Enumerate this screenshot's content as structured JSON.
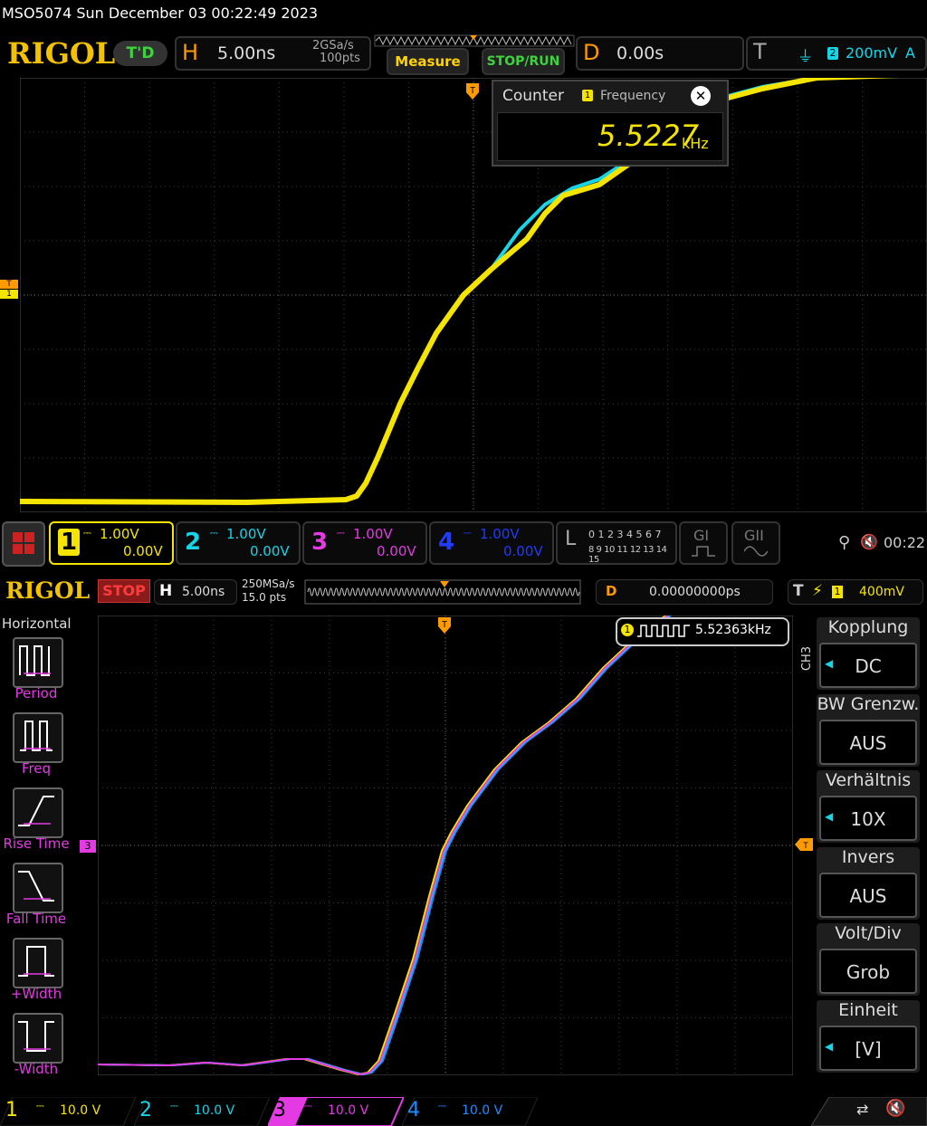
{
  "top": {
    "title": "MSO5074  Sun December 03 00:22:49 2023",
    "logo": "RIGOL",
    "td_badge": "T'D",
    "h_label": "H",
    "h_timebase": "5.00ns",
    "h_sa": "2GSa/s",
    "h_pts": "100pts",
    "measure_label": "Measure",
    "stoprun_label": "STOP/RUN",
    "d_label": "D",
    "d_value": "0.00s",
    "t_label": "T",
    "t_channel": "2",
    "t_level": "200mV",
    "t_mode": "A",
    "counter": {
      "title": "Counter",
      "channel": "1",
      "type": "Frequency",
      "value": "5.5227",
      "unit": "kHz"
    },
    "channels": [
      {
        "num": "1",
        "volt": "1.00V",
        "offset": "0.00V",
        "color": "#f5e400"
      },
      {
        "num": "2",
        "volt": "1.00V",
        "offset": "0.00V",
        "color": "#19d4e6"
      },
      {
        "num": "3",
        "volt": "1.00V",
        "offset": "0.00V",
        "color": "#e43ae4"
      },
      {
        "num": "4",
        "volt": "1.00V",
        "offset": "0.00V",
        "color": "#1f3cff"
      }
    ],
    "logic_label": "L",
    "logic_row1": "0 1 2 3  4 5 6 7",
    "logic_row2": "8  9 10 11  12 13 14 15",
    "g1": "GI",
    "g2": "GII",
    "clock": "00:22",
    "ch_marker_t": "T",
    "ch_marker_1": "1"
  },
  "bottom": {
    "logo": "RIGOL",
    "status": "STOP",
    "h_label": "H",
    "h_timebase": "5.00ns",
    "h_sa": "250MSa/s",
    "h_pts": "15.0  pts",
    "d_label": "D",
    "d_value": "0.00000000ps",
    "t_label": "T",
    "t_channel": "1",
    "t_level": "400mV",
    "side_title": "Horizontal",
    "side_items": [
      "Period",
      "Freq",
      "Rise Time",
      "Fall Time",
      "+Width",
      "-Width"
    ],
    "freq_channel": "1",
    "freq_value": "5.52363kHz",
    "ch3_label": "CH3",
    "ch3_marker": "3",
    "right_menu": [
      {
        "title": "Kopplung",
        "value": "DC"
      },
      {
        "title": "BW Grenzw.",
        "value": "AUS"
      },
      {
        "title": "Verhältnis",
        "value": "10X"
      },
      {
        "title": "Invers",
        "value": "AUS"
      },
      {
        "title": "Volt/Div",
        "value": "Grob"
      },
      {
        "title": "Einheit",
        "value": "[V]"
      }
    ],
    "channels": [
      {
        "num": "1",
        "volt": "10.0 V",
        "color": "#f5e400"
      },
      {
        "num": "2",
        "volt": "10.0 V",
        "color": "#19d4e6"
      },
      {
        "num": "3",
        "volt": "10.0 V",
        "color": "#e43ae4"
      },
      {
        "num": "4",
        "volt": "10.0 V",
        "color": "#1f8cff"
      }
    ]
  }
}
